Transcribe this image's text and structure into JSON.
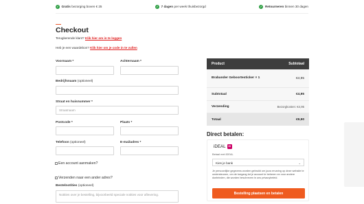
{
  "usp": [
    {
      "bold": "Gratis",
      "text": "bezorging boven € 25"
    },
    {
      "bold": "7 dagen",
      "text": "per week thuisbezorgd"
    },
    {
      "bold": "Retourneren",
      "text": "binnen 30 dagen"
    }
  ],
  "page": {
    "title": "Checkout"
  },
  "notices": {
    "returning": {
      "text": "Terugkerende klant?",
      "link": "Klik hier om in te loggen"
    },
    "coupon": {
      "text": "Heb je een waardebon?",
      "link": "Klik hier om je code in te vullen"
    }
  },
  "form": {
    "first_name": {
      "label": "Voornaam *"
    },
    "last_name": {
      "label": "Achternaam *"
    },
    "company": {
      "label": "Bedrijfsnaam",
      "optional": "(optioneel)"
    },
    "street": {
      "label": "Straat en huisnummer *",
      "placeholder": "Straatnaam"
    },
    "postcode": {
      "label": "Postcode *"
    },
    "city": {
      "label": "Plaats *"
    },
    "phone": {
      "label": "Telefoon",
      "optional": "(optioneel)"
    },
    "email": {
      "label": "E-mailadres *"
    },
    "create_account": "Een account aanmaken?",
    "ship_different": "Verzenden naar een ander adres?",
    "notes": {
      "label": "Bestelnotities",
      "optional": "(optioneel)",
      "placeholder": "Notities over je bestelling, bijvoorbeeld speciale notities voor aflevering."
    }
  },
  "order_summary": {
    "header_product": "Product",
    "header_subtotal": "Subtotaal",
    "item_name": "Brabander Geboortesticker",
    "item_qty": "× 1",
    "item_price": "€4,95",
    "subtotal_label": "Subtotaal",
    "subtotal_value": "€4,95",
    "shipping_label": "Verzending",
    "shipping_value": "Bezorgkosten: €4,95",
    "total_label": "Totaal",
    "total_value": "€9,90"
  },
  "payment": {
    "title": "Direct betalen:",
    "method": "iDEAL",
    "logo_text": "iD",
    "method_sub": "Betaal met iDEAL",
    "bank_select": "Kies je bank",
    "privacy": "Je persoonlijke gegevens worden gebruikt om jouw ervaring op deze website te ondersteunen, om de toegang tot je account te beheren en voor andere doeleinden, die worden beschreven in ons privacybeleid.",
    "place_order": "Bestelling plaatsen en betalen"
  },
  "colors": {
    "accent": "#ef5b1f",
    "link": "#e02020",
    "check": "#2e9e43",
    "ideal": "#cc0066"
  }
}
